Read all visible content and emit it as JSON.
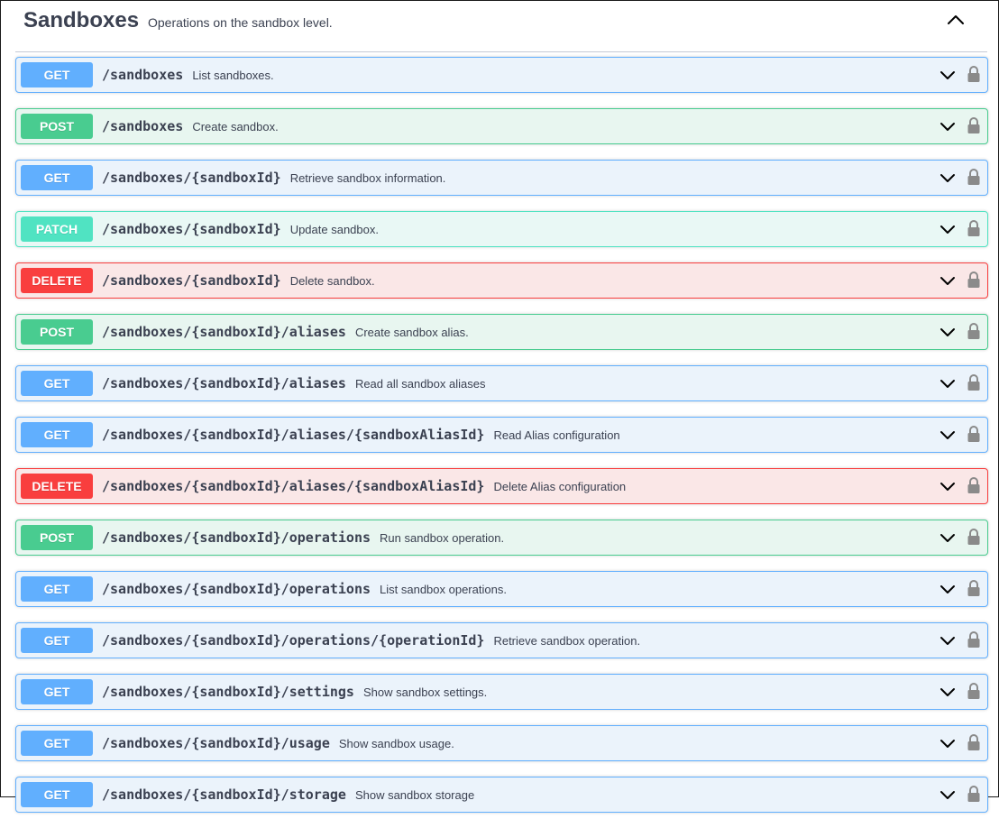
{
  "tag": {
    "title": "Sandboxes",
    "description": "Operations on the sandbox level."
  },
  "colors": {
    "get": "#61affe",
    "post": "#49cc90",
    "patch": "#50e3c2",
    "delete": "#f93e3e"
  },
  "operations": [
    {
      "method": "GET",
      "path": "/sandboxes",
      "summary": "List sandboxes."
    },
    {
      "method": "POST",
      "path": "/sandboxes",
      "summary": "Create sandbox."
    },
    {
      "method": "GET",
      "path": "/sandboxes/{sandboxId}",
      "summary": "Retrieve sandbox information."
    },
    {
      "method": "PATCH",
      "path": "/sandboxes/{sandboxId}",
      "summary": "Update sandbox."
    },
    {
      "method": "DELETE",
      "path": "/sandboxes/{sandboxId}",
      "summary": "Delete sandbox."
    },
    {
      "method": "POST",
      "path": "/sandboxes/{sandboxId}/aliases",
      "summary": "Create sandbox alias."
    },
    {
      "method": "GET",
      "path": "/sandboxes/{sandboxId}/aliases",
      "summary": "Read all sandbox aliases"
    },
    {
      "method": "GET",
      "path": "/sandboxes/{sandboxId}/aliases/{sandboxAliasId}",
      "summary": "Read Alias configuration"
    },
    {
      "method": "DELETE",
      "path": "/sandboxes/{sandboxId}/aliases/{sandboxAliasId}",
      "summary": "Delete Alias configuration"
    },
    {
      "method": "POST",
      "path": "/sandboxes/{sandboxId}/operations",
      "summary": "Run sandbox operation."
    },
    {
      "method": "GET",
      "path": "/sandboxes/{sandboxId}/operations",
      "summary": "List sandbox operations."
    },
    {
      "method": "GET",
      "path": "/sandboxes/{sandboxId}/operations/{operationId}",
      "summary": "Retrieve sandbox operation."
    },
    {
      "method": "GET",
      "path": "/sandboxes/{sandboxId}/settings",
      "summary": "Show sandbox settings."
    },
    {
      "method": "GET",
      "path": "/sandboxes/{sandboxId}/usage",
      "summary": "Show sandbox usage."
    },
    {
      "method": "GET",
      "path": "/sandboxes/{sandboxId}/storage",
      "summary": "Show sandbox storage"
    }
  ]
}
